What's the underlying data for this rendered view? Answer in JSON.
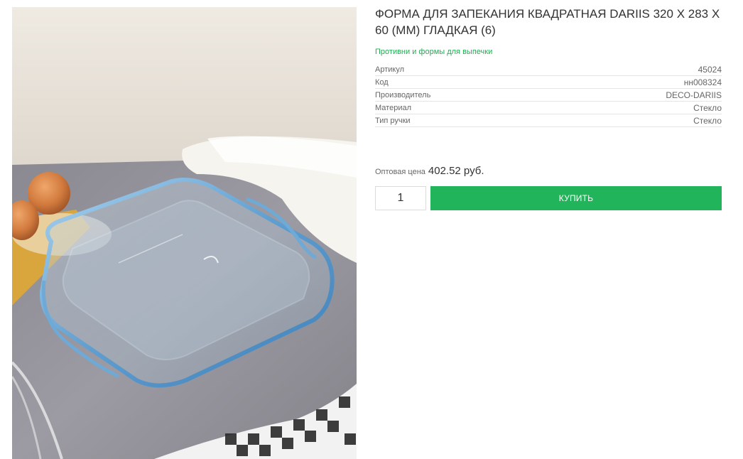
{
  "product": {
    "title": "ФОРМА ДЛЯ ЗАПЕКАНИЯ КВАДРАТНАЯ DARIIS 320 Х 283 Х 60 (ММ) ГЛАДКАЯ (6)",
    "category": "Противни и формы для выпечки",
    "image_alt": "glass-square-baking-dish-photo"
  },
  "specs": [
    {
      "label": "Артикул",
      "value": "45024"
    },
    {
      "label": "Код",
      "value": "нн008324"
    },
    {
      "label": "Производитель",
      "value": "DECO-DARIIS"
    },
    {
      "label": "Материал",
      "value": "Стекло"
    },
    {
      "label": "Тип ручки",
      "value": "Стекло"
    }
  ],
  "price": {
    "label": "Оптовая цена",
    "value": "402.52 руб."
  },
  "purchase": {
    "quantity": "1",
    "buy_label": "КУПИТЬ"
  },
  "colors": {
    "accent": "#22b45a",
    "link": "#1fae52"
  }
}
